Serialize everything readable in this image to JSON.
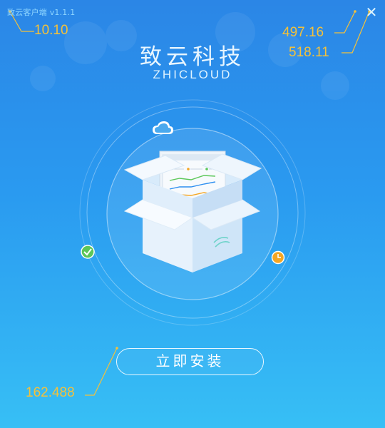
{
  "window": {
    "title": "致云客户端 v1.1.1",
    "close_glyph": "✕"
  },
  "brand": {
    "name_cn": "致云科技",
    "name_en": "ZHICLOUD"
  },
  "annotations": {
    "a1": "10.10",
    "a2": "497.16",
    "a3": "518.11",
    "a4": "162.488"
  },
  "actions": {
    "install_label": "立即安装"
  },
  "icons": [
    "cloud-icon",
    "check-icon",
    "clock-icon",
    "box-illustration",
    "close-icon"
  ],
  "colors": {
    "bg_top": "#2b86e6",
    "bg_bottom": "#37bff5",
    "annotation": "#f4c13a",
    "check": "#5cc65a",
    "clock": "#f5a623",
    "chart_green": "#5cc85a",
    "chart_blue": "#2e8ff0",
    "chart_orange": "#f5a623"
  }
}
